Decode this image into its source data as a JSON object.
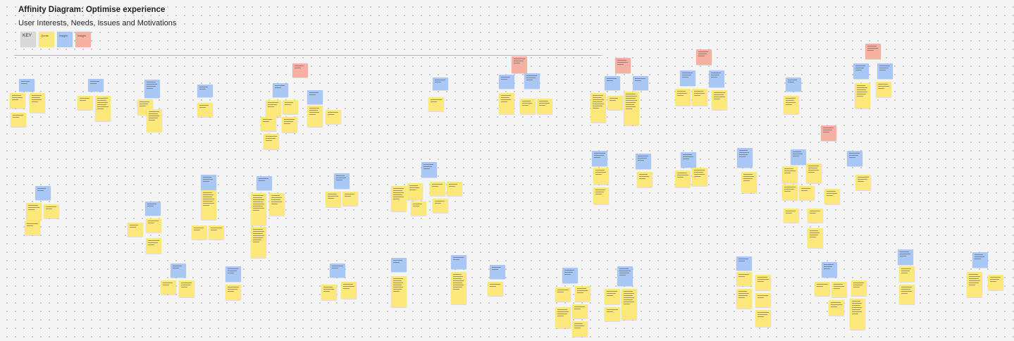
{
  "header": {
    "title": "Affinity Diagram: Optimise experience",
    "subtitle": "User Interests, Needs, Issues and Motivations"
  },
  "key": {
    "label": "KEY",
    "swatches": [
      {
        "name": "key-swatch-grey",
        "color": "#d8d8d8",
        "text": "KEY"
      },
      {
        "name": "key-swatch-yellow",
        "color": "#fbe77a",
        "text": "Quote"
      },
      {
        "name": "key-swatch-blue",
        "color": "#a9c7f5",
        "text": "Insight"
      },
      {
        "name": "key-swatch-red",
        "color": "#f6b0a2",
        "text": "Insight"
      }
    ]
  },
  "colors": {
    "canvas": "#f4f4f4",
    "grid_dot": "#c9c9c9",
    "yellow_note": "#fbe77a",
    "blue_note": "#a9c7f5",
    "red_note": "#f6b0a2",
    "grey_note": "#d8d8d8"
  },
  "note_summary": {
    "note_colors": [
      "yellow",
      "blue",
      "red"
    ]
  }
}
